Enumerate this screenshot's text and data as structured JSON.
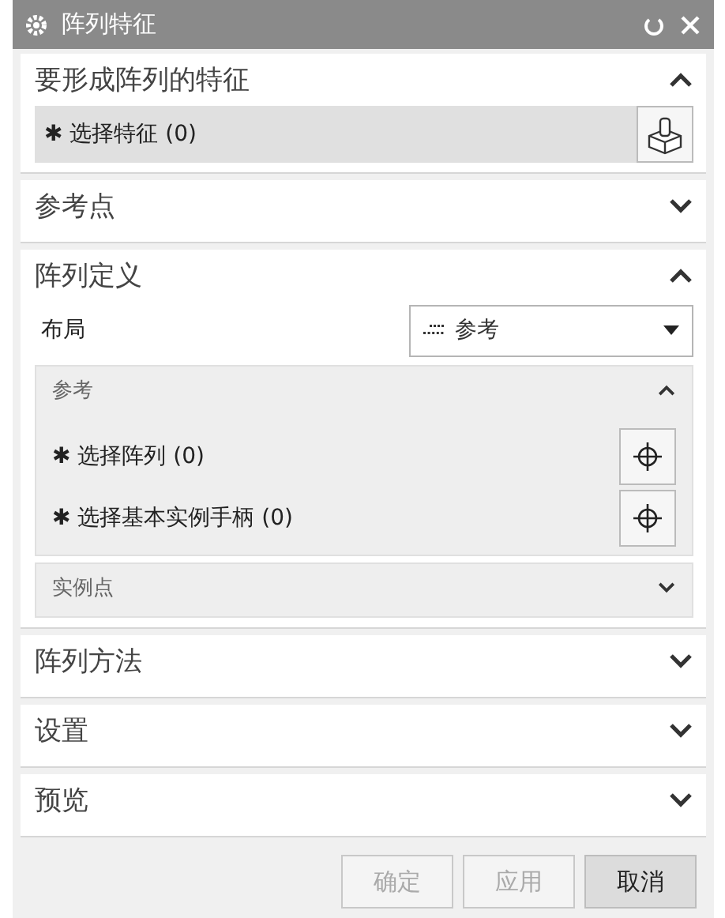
{
  "window": {
    "title": "阵列特征"
  },
  "sections": [
    {
      "kind": "feature",
      "title": "要形成阵列的特征",
      "expanded": true,
      "selection": {
        "label": "✱ 选择特征 (0)",
        "selected": true
      }
    },
    {
      "title": "参考点",
      "expanded": false
    },
    {
      "kind": "definition",
      "title": "阵列定义",
      "expanded": true,
      "layout": {
        "label": "布局",
        "value": "参考"
      },
      "group": {
        "title": "参考",
        "expanded": true,
        "rows": [
          {
            "label": "✱ 选择阵列 (0)"
          },
          {
            "label": "✱ 选择基本实例手柄 (0)"
          }
        ]
      },
      "subgroup": {
        "title": "实例点",
        "expanded": false
      }
    },
    {
      "title": "阵列方法",
      "expanded": false
    },
    {
      "title": "设置",
      "expanded": false
    },
    {
      "title": "预览",
      "expanded": false
    }
  ],
  "buttons": [
    {
      "label": "确定",
      "disabled": true
    },
    {
      "label": "应用",
      "disabled": true
    },
    {
      "label": "取消",
      "disabled": false
    }
  ]
}
